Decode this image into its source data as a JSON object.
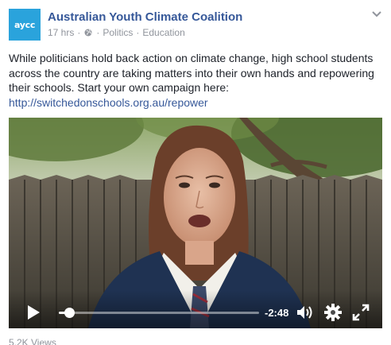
{
  "post": {
    "page_name": "Australian Youth Climate Coalition",
    "avatar_text": "aycc",
    "time": "17 hrs",
    "separator": "·",
    "categories": [
      "Politics",
      "Education"
    ],
    "text": "While politicians hold back action on climate change, high school students across the country are taking matters into their own hands and repowering their schools. Start your own campaign here:",
    "link": "http://switchedonschools.org.au/repower",
    "views": "5.2K Views"
  },
  "video": {
    "time_remaining": "-2:48",
    "progress": 0.05,
    "icons": [
      "play-icon",
      "volume-icon",
      "gear-icon",
      "fullscreen-icon"
    ]
  },
  "colors": {
    "brand": "#2aa3dc",
    "link": "#365899",
    "meta": "#90949c"
  }
}
